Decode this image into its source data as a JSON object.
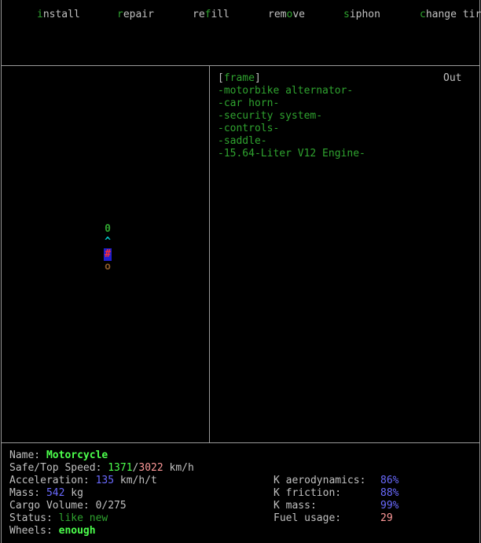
{
  "menu": [
    {
      "name": "install",
      "hotkey": "i",
      "rest": "nstall"
    },
    {
      "name": "repair",
      "hotkey": "r",
      "rest": "epair"
    },
    {
      "name": "refill",
      "pre": "re",
      "hotkey": "f",
      "rest": "ill"
    },
    {
      "name": "remove",
      "pre": "rem",
      "hotkey": "o",
      "rest": "ve"
    },
    {
      "name": "siphon",
      "hotkey": "s",
      "rest": "iphon"
    },
    {
      "name": "change",
      "hotkey": "c",
      "rest": "hange tir"
    }
  ],
  "parts_panel": {
    "selected": "frame",
    "status_label": "Out",
    "parts": [
      "frame",
      "motorbike alternator",
      "car horn",
      "security system",
      "controls",
      "saddle",
      "15.64-Liter V12 Engine"
    ]
  },
  "vehicle_glyphs": [
    {
      "symbol": "0",
      "color": "#2fa32f",
      "bg": "#000000"
    },
    {
      "symbol": "^",
      "color": "#00cccc",
      "bg": "#000000"
    },
    {
      "symbol": "#",
      "color": "#ff3030",
      "bg": "#1f1fcf"
    },
    {
      "symbol": "o",
      "color": "#8b5a2b",
      "bg": "#000000"
    }
  ],
  "stats_left": {
    "name_label": "Name:",
    "name_value": "Motorcycle",
    "speed_label": "Safe/Top Speed:",
    "safe_speed": "1371",
    "speed_sep": "/",
    "top_speed": "3022",
    "speed_unit": "km/h",
    "accel_label": "Acceleration:",
    "accel_value": "135",
    "accel_unit": "km/h/t",
    "mass_label": "Mass:",
    "mass_value": "542",
    "mass_unit": "kg",
    "cargo_label": "Cargo Volume:",
    "cargo_value": "0/275",
    "status_label": "Status:",
    "status_value": "like new",
    "wheels_label": "Wheels:",
    "wheels_value": "enough"
  },
  "stats_right": {
    "aero_label": "K aerodynamics:",
    "aero_value": "86%",
    "friction_label": "K friction:",
    "friction_value": "88%",
    "kmass_label": "K mass:",
    "kmass_value": "99%",
    "fuel_label": "Fuel usage:",
    "fuel_value": "29"
  },
  "colors": {
    "bright_green": "#4cff4c",
    "green": "#2fa32f",
    "blue": "#6a6aff",
    "pink": "#ff9a9a",
    "gray": "#c0c0c0"
  }
}
